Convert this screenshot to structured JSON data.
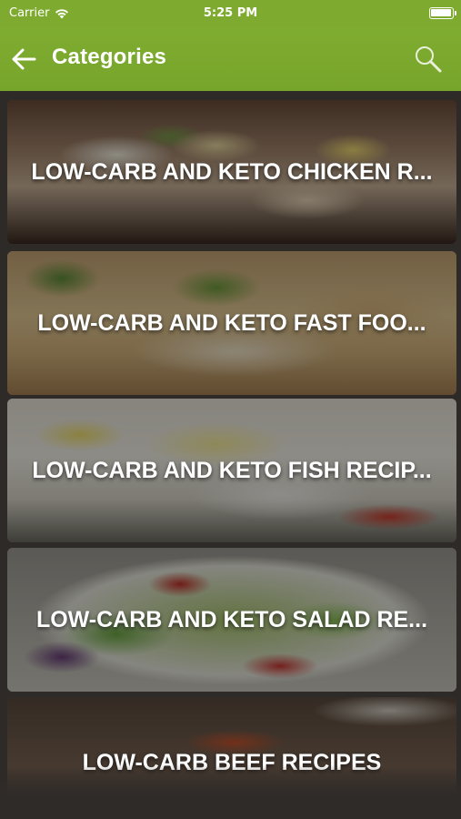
{
  "statusbar": {
    "carrier": "Carrier",
    "time": "5:25 PM",
    "battery_level": 1.0
  },
  "navbar": {
    "title": "Categories",
    "back_icon": "arrow-left-icon",
    "search_icon": "search-icon",
    "background_color": "#7eab2f"
  },
  "categories": [
    {
      "title": "LOW-CARB AND KETO CHICKEN R..."
    },
    {
      "title": "LOW-CARB AND KETO FAST FOO..."
    },
    {
      "title": "LOW-CARB AND KETO FISH RECIP..."
    },
    {
      "title": "LOW-CARB AND KETO SALAD RE..."
    },
    {
      "title": "LOW-CARB BEEF RECIPES"
    }
  ]
}
